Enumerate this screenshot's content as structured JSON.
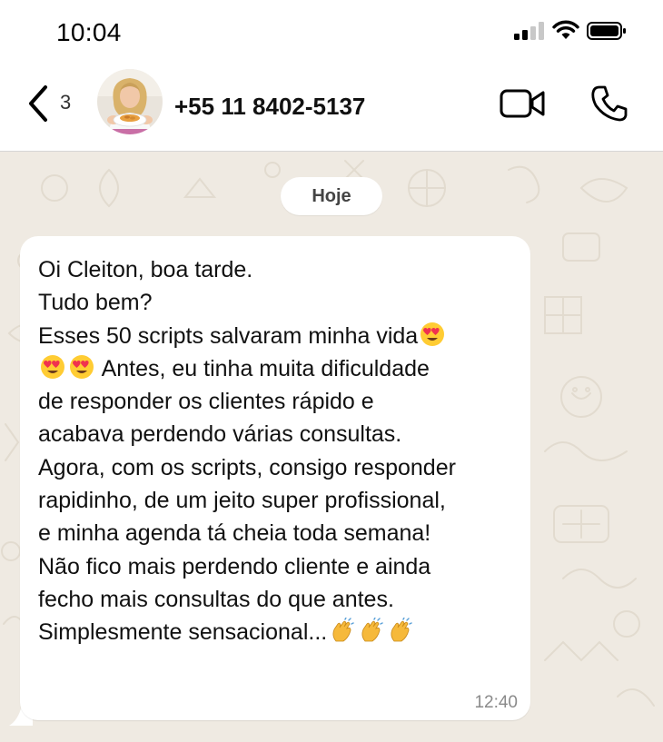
{
  "status_bar": {
    "time": "10:04"
  },
  "header": {
    "back_count": "3",
    "contact_name": "+55 11 8402-5137"
  },
  "chat": {
    "date_label": "Hoje",
    "message": {
      "lines": [
        "Oi Cleiton, boa tarde.",
        "Tudo bem?",
        "Esses 50 scripts salvaram minha vida",
        " Antes, eu tinha muita dificuldade",
        "de responder os clientes rápido e",
        "acabava perdendo várias consultas.",
        "Agora, com os scripts, consigo responder",
        "rapidinho, de um jeito super profissional,",
        "e minha agenda tá cheia toda semana!",
        "Não fico mais perdendo cliente e ainda",
        "fecho mais consultas do que antes.",
        "Simplesmente sensacional..."
      ],
      "time": "12:40"
    }
  },
  "colors": {
    "chat_background": "#efeae2",
    "bubble": "#ffffff",
    "emoji_face": "#ffcc33",
    "emoji_heart": "#f0314f",
    "emoji_clap": "#f6b93b"
  },
  "icons": {
    "back": "chevron-left-icon",
    "video": "video-camera-icon",
    "call": "phone-icon",
    "emoji_love": "heart-eyes-emoji",
    "emoji_clap": "clapping-hands-emoji"
  }
}
